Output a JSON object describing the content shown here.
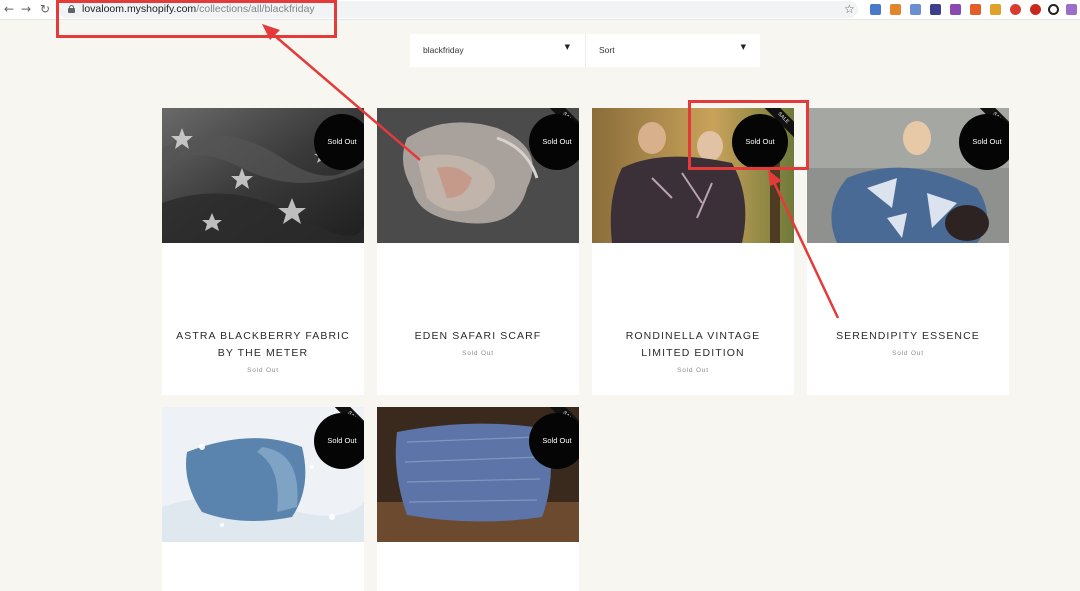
{
  "browser": {
    "url_host": "lovaloom.myshopify.com",
    "url_path": "/collections/all/blackfriday",
    "extensions": [
      "ext-a",
      "ext-b",
      "ext-c",
      "ext-d",
      "ext-e",
      "ext-f",
      "ext-g",
      "ext-h",
      "ext-i",
      "ext-j",
      "ext-k",
      "ext-l"
    ]
  },
  "filters": {
    "collection": "blackfriday",
    "sort": "Sort"
  },
  "badges": {
    "sold_out": "Sold Out",
    "sale": "SALE"
  },
  "products": [
    {
      "title": "ASTRA BLACKBERRY FABRIC BY THE METER",
      "status": "Sold Out"
    },
    {
      "title": "EDEN SAFARI SCARF",
      "status": "Sold Out"
    },
    {
      "title": "RONDINELLA VINTAGE LIMITED EDITION",
      "status": "Sold Out"
    },
    {
      "title": "SERENDIPITY ESSENCE",
      "status": "Sold Out"
    },
    {
      "title": "",
      "status": ""
    },
    {
      "title": "",
      "status": ""
    }
  ]
}
